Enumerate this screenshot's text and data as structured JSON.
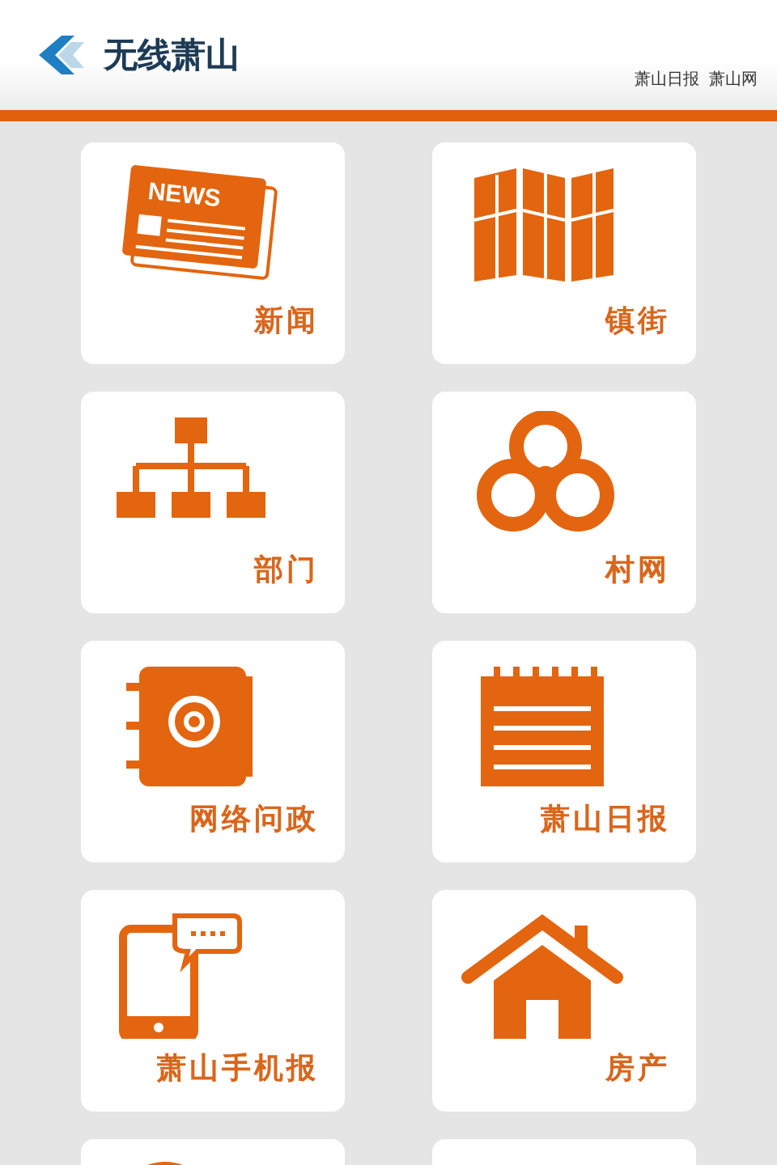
{
  "header": {
    "title": "无线萧山",
    "links": [
      "萧山日报",
      "萧山网"
    ]
  },
  "tiles": [
    {
      "icon_text": "NEWS",
      "label": "新闻"
    },
    {
      "label": "镇街"
    },
    {
      "label": "部门"
    },
    {
      "label": "村网"
    },
    {
      "label": "网络问政"
    },
    {
      "label": "萧山日报"
    },
    {
      "label": "萧山手机报"
    },
    {
      "label": "房产"
    }
  ]
}
